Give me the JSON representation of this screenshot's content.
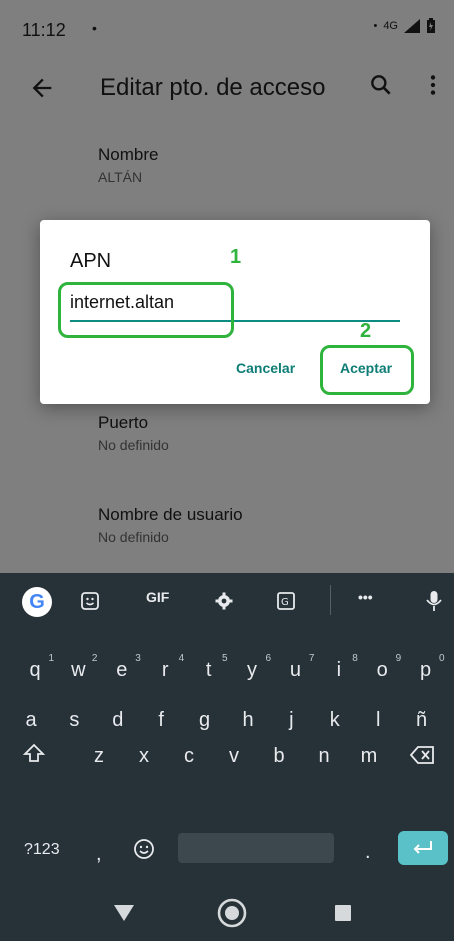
{
  "status_bar": {
    "time": "11:12",
    "notification_dot": "•",
    "network_label": "4G"
  },
  "toolbar": {
    "title": "Editar pto. de acceso",
    "icons": [
      "back-arrow-icon",
      "search-icon",
      "more-vert-icon"
    ]
  },
  "settings": [
    {
      "title": "Nombre",
      "value": "ALTÁN"
    },
    {
      "title": "Puerto",
      "value": "No definido"
    },
    {
      "title": "Nombre de usuario",
      "value": "No definido"
    }
  ],
  "dialog": {
    "title": "APN",
    "input_value": "internet.altan",
    "cancel_label": "Cancelar",
    "accept_label": "Aceptar"
  },
  "annotations": {
    "step1": "1",
    "step2": "2",
    "color": "#2eb43d"
  },
  "keyboard": {
    "toolbar": {
      "gif_label": "GIF",
      "more_label": "•••"
    },
    "row1": [
      {
        "key": "q",
        "num": "1"
      },
      {
        "key": "w",
        "num": "2"
      },
      {
        "key": "e",
        "num": "3"
      },
      {
        "key": "r",
        "num": "4"
      },
      {
        "key": "t",
        "num": "5"
      },
      {
        "key": "y",
        "num": "6"
      },
      {
        "key": "u",
        "num": "7"
      },
      {
        "key": "i",
        "num": "8"
      },
      {
        "key": "o",
        "num": "9"
      },
      {
        "key": "p",
        "num": "0"
      }
    ],
    "row2": [
      "a",
      "s",
      "d",
      "f",
      "g",
      "h",
      "j",
      "k",
      "l",
      "ñ"
    ],
    "row3": [
      "z",
      "x",
      "c",
      "v",
      "b",
      "n",
      "m"
    ],
    "row4": {
      "symbols_label": "?123",
      "comma": ",",
      "period": "."
    },
    "colors": {
      "background": "#263238",
      "enter": "#5bc1c9"
    }
  },
  "nav": {
    "icons": [
      "back-triangle-icon",
      "home-circle-icon",
      "recents-square-icon"
    ]
  }
}
